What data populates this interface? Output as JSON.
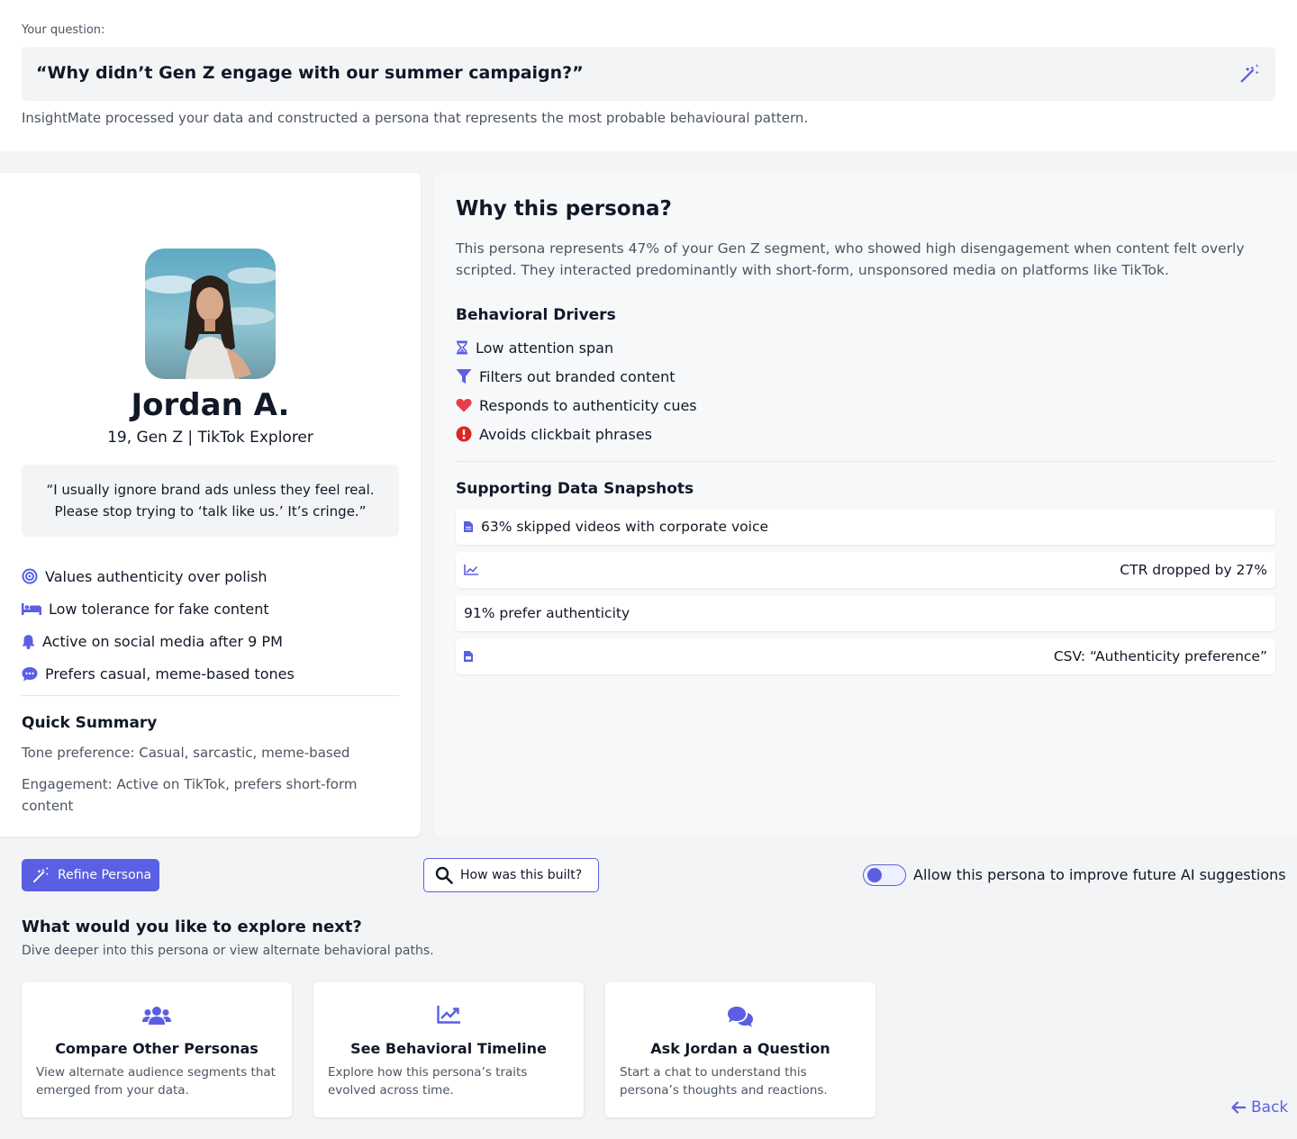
{
  "question": {
    "label": "Your question:",
    "text": "“Why didn’t Gen Z engage with our summer campaign?”",
    "subtext": "InsightMate processed your data and constructed a persona that represents the most probable behavioural pattern."
  },
  "persona": {
    "name": "Jordan A.",
    "meta": "19, Gen Z | TikTok Explorer",
    "quote": "“I usually ignore brand ads unless they feel real. Please stop trying to ‘talk like us.’ It’s cringe.”",
    "traits": [
      {
        "label": "Values authenticity over polish",
        "icon": "target-icon"
      },
      {
        "label": "Low tolerance for fake content",
        "icon": "bed-icon"
      },
      {
        "label": "Active on social media after 9 PM",
        "icon": "bell-icon"
      },
      {
        "label": "Prefers casual, meme-based tones",
        "icon": "chat-bubble-icon"
      }
    ],
    "summary": {
      "title": "Quick Summary",
      "tone": "Tone preference: Casual, sarcastic, meme-based",
      "engagement": "Engagement: Active on TikTok, prefers short-form content"
    }
  },
  "why": {
    "title": "Why this persona?",
    "body": "This persona represents 47% of your Gen Z segment, who showed high disengagement when content felt overly scripted. They interacted predominantly with short-form, unsponsored media on platforms like TikTok.",
    "drivers_title": "Behavioral Drivers",
    "drivers": [
      {
        "label": "Low attention span",
        "icon": "hourglass-icon"
      },
      {
        "label": "Filters out branded content",
        "icon": "filter-icon"
      },
      {
        "label": "Responds to authenticity cues",
        "icon": "heart-icon"
      },
      {
        "label": "Avoids clickbait phrases",
        "icon": "alert-icon"
      }
    ],
    "snapshots_title": "Supporting Data Snapshots",
    "snapshots": [
      {
        "label": "63% skipped videos with corporate voice",
        "icon": "document-icon"
      },
      {
        "label": "CTR dropped by 27%",
        "icon": "chart-line-icon"
      },
      {
        "label": "91% prefer authenticity",
        "icon": ""
      },
      {
        "label": "CSV: “Authenticity preference”",
        "icon": "csv-file-icon"
      }
    ]
  },
  "actions": {
    "refine_label": "Refine Persona",
    "how_label": "How was this built?",
    "toggle_label": "Allow this persona to improve future AI suggestions",
    "toggle_on": true
  },
  "explore": {
    "title": "What would you like to explore next?",
    "subtitle": "Dive deeper into this persona or view alternate behavioral paths.",
    "cards": [
      {
        "title": "Compare Other Personas",
        "desc": "View alternate audience segments that emerged from your data.",
        "icon": "users-icon"
      },
      {
        "title": "See Behavioral Timeline",
        "desc": "Explore how this persona’s traits evolved across time.",
        "icon": "chart-line-icon"
      },
      {
        "title": "Ask Jordan a Question",
        "desc": "Start a chat to understand this persona’s thoughts and reactions.",
        "icon": "comments-icon"
      }
    ]
  },
  "back_label": "Back",
  "colors": {
    "accent": "#5b5fe3",
    "heart": "#e53e4a",
    "alert": "#dc2626"
  }
}
